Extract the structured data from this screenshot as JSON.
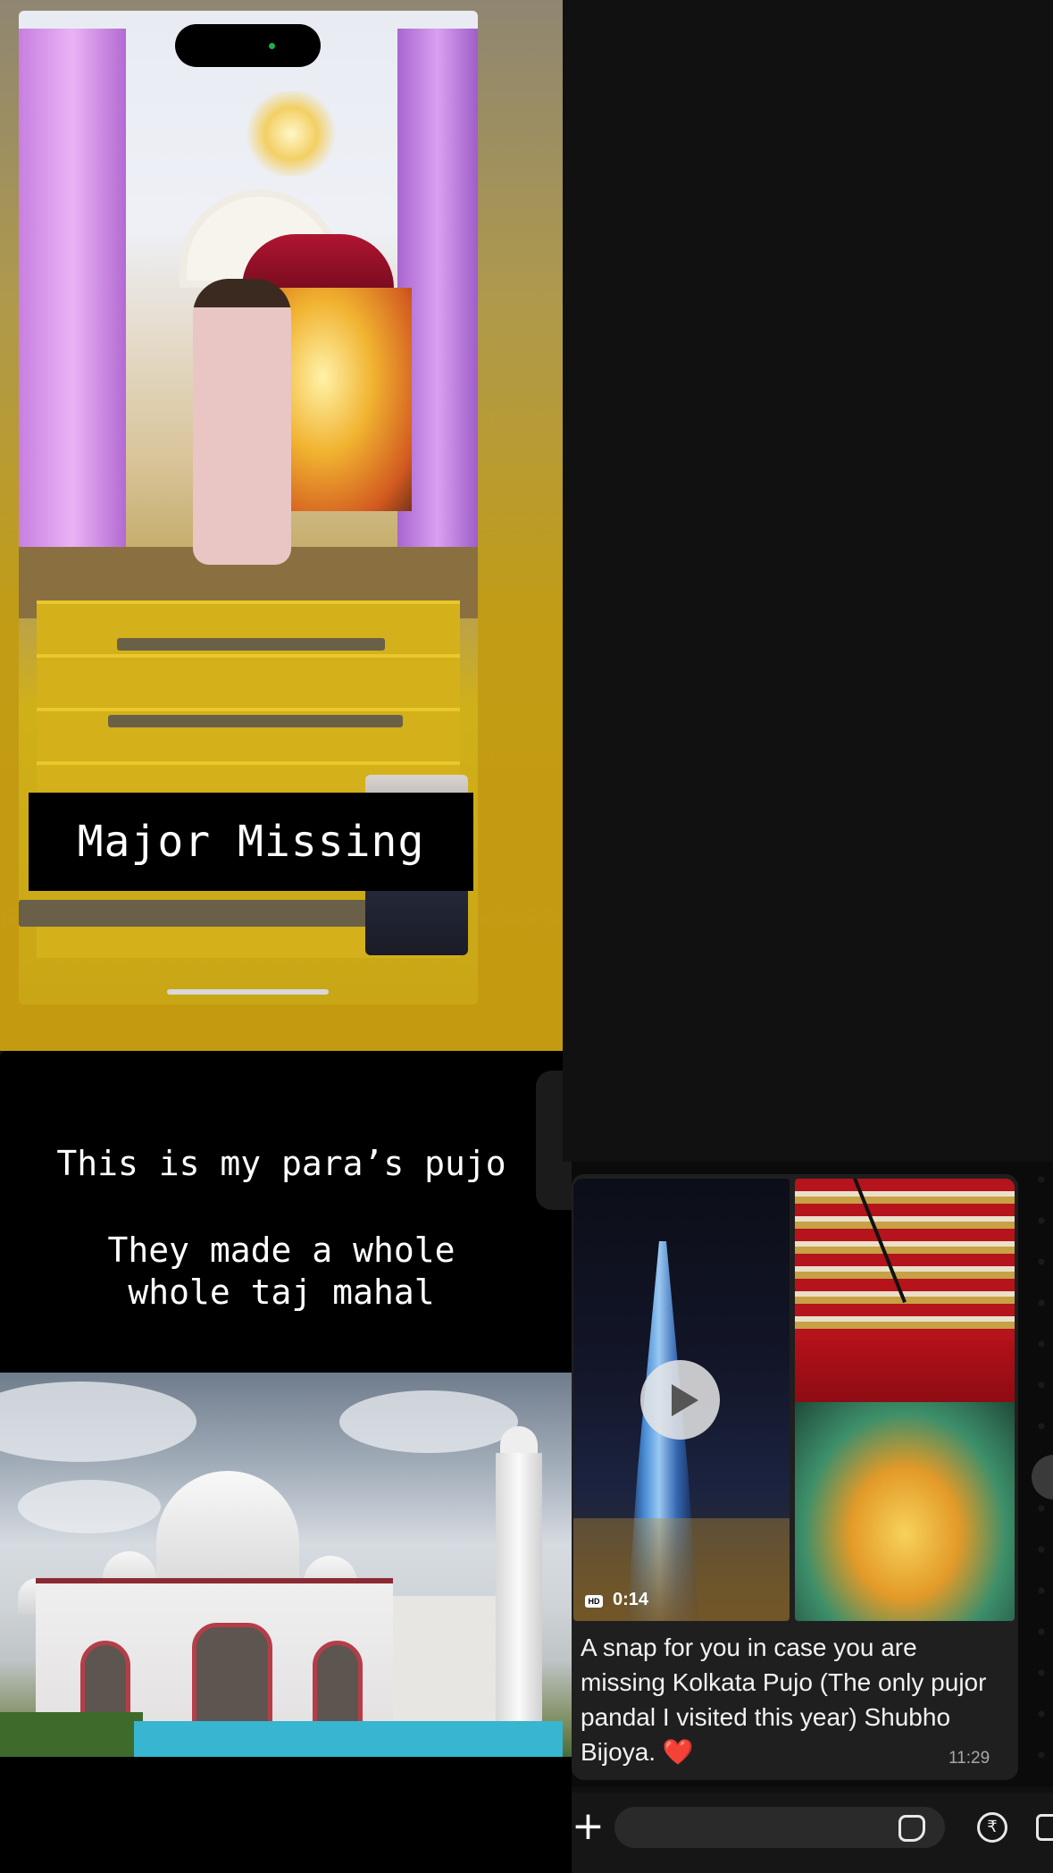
{
  "story": {
    "caption": "Major Missing"
  },
  "text_slide": {
    "line1": "This is my para’s pujo",
    "line2": "They made a whole",
    "line3": "whole taj mahal"
  },
  "chat": {
    "video": {
      "badge": "HD",
      "duration": "0:14"
    },
    "message": {
      "text": "A snap for you in case you are missing Kolkata Pujo (The only pujor pandal I visited this year) Shubho Bijoya.",
      "emoji": "❤️",
      "time": "11:29"
    },
    "composer": {
      "plus": "+",
      "value": "",
      "rupee_symbol": "₹"
    }
  },
  "icons": {
    "play": "play-icon",
    "sticker": "sticker-icon",
    "rupee": "rupee-icon",
    "camera": "camera-icon",
    "plus": "plus-icon"
  },
  "colors": {
    "story_bg": "#c49a10",
    "chat_bg": "#111111",
    "bubble": "#1f1f1f",
    "heart": "#e0262f"
  }
}
